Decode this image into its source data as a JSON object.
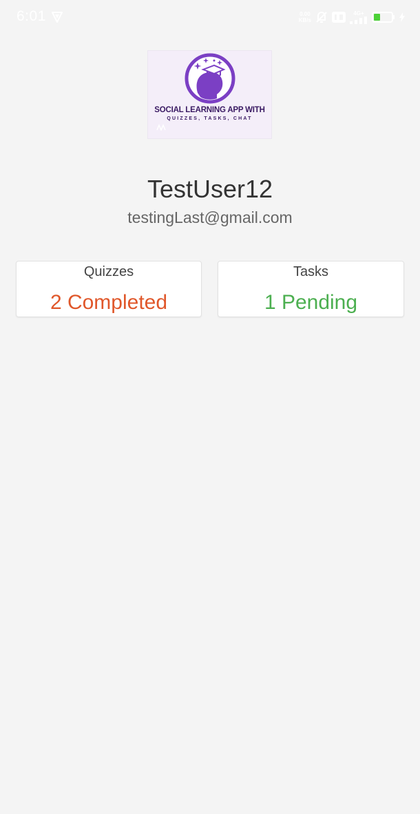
{
  "status_bar": {
    "time": "6:01",
    "network_speed_value": "0.00",
    "network_speed_unit": "KB/s",
    "network_type": "4G+",
    "battery_level": "35"
  },
  "logo": {
    "line1": "SOCIAL LEARNING APP WITH",
    "line2": "QUIZZES, TASKS, CHAT"
  },
  "profile": {
    "username": "TestUser12",
    "email": "testingLast@gmail.com"
  },
  "stats": {
    "quizzes": {
      "label": "Quizzes",
      "value": "2 Completed"
    },
    "tasks": {
      "label": "Tasks",
      "value": "1 Pending"
    }
  },
  "colors": {
    "background": "#f4f4f4",
    "quizzes_value": "#e0572a",
    "tasks_value": "#4caf50",
    "logo_purple": "#7b3fc4",
    "battery_green": "#4cd137"
  }
}
